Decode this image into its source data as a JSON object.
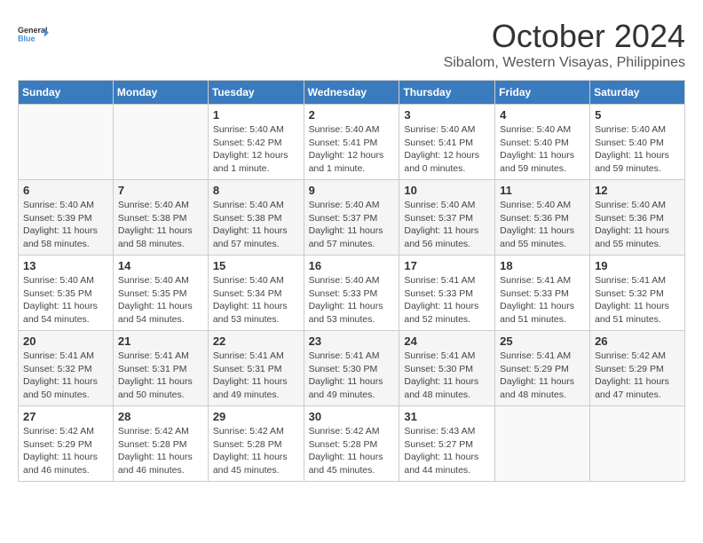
{
  "logo": {
    "line1": "General",
    "line2": "Blue"
  },
  "title": "October 2024",
  "subtitle": "Sibalom, Western Visayas, Philippines",
  "headers": [
    "Sunday",
    "Monday",
    "Tuesday",
    "Wednesday",
    "Thursday",
    "Friday",
    "Saturday"
  ],
  "weeks": [
    [
      {
        "day": "",
        "info": ""
      },
      {
        "day": "",
        "info": ""
      },
      {
        "day": "1",
        "info": "Sunrise: 5:40 AM\nSunset: 5:42 PM\nDaylight: 12 hours\nand 1 minute."
      },
      {
        "day": "2",
        "info": "Sunrise: 5:40 AM\nSunset: 5:41 PM\nDaylight: 12 hours\nand 1 minute."
      },
      {
        "day": "3",
        "info": "Sunrise: 5:40 AM\nSunset: 5:41 PM\nDaylight: 12 hours\nand 0 minutes."
      },
      {
        "day": "4",
        "info": "Sunrise: 5:40 AM\nSunset: 5:40 PM\nDaylight: 11 hours\nand 59 minutes."
      },
      {
        "day": "5",
        "info": "Sunrise: 5:40 AM\nSunset: 5:40 PM\nDaylight: 11 hours\nand 59 minutes."
      }
    ],
    [
      {
        "day": "6",
        "info": "Sunrise: 5:40 AM\nSunset: 5:39 PM\nDaylight: 11 hours\nand 58 minutes."
      },
      {
        "day": "7",
        "info": "Sunrise: 5:40 AM\nSunset: 5:38 PM\nDaylight: 11 hours\nand 58 minutes."
      },
      {
        "day": "8",
        "info": "Sunrise: 5:40 AM\nSunset: 5:38 PM\nDaylight: 11 hours\nand 57 minutes."
      },
      {
        "day": "9",
        "info": "Sunrise: 5:40 AM\nSunset: 5:37 PM\nDaylight: 11 hours\nand 57 minutes."
      },
      {
        "day": "10",
        "info": "Sunrise: 5:40 AM\nSunset: 5:37 PM\nDaylight: 11 hours\nand 56 minutes."
      },
      {
        "day": "11",
        "info": "Sunrise: 5:40 AM\nSunset: 5:36 PM\nDaylight: 11 hours\nand 55 minutes."
      },
      {
        "day": "12",
        "info": "Sunrise: 5:40 AM\nSunset: 5:36 PM\nDaylight: 11 hours\nand 55 minutes."
      }
    ],
    [
      {
        "day": "13",
        "info": "Sunrise: 5:40 AM\nSunset: 5:35 PM\nDaylight: 11 hours\nand 54 minutes."
      },
      {
        "day": "14",
        "info": "Sunrise: 5:40 AM\nSunset: 5:35 PM\nDaylight: 11 hours\nand 54 minutes."
      },
      {
        "day": "15",
        "info": "Sunrise: 5:40 AM\nSunset: 5:34 PM\nDaylight: 11 hours\nand 53 minutes."
      },
      {
        "day": "16",
        "info": "Sunrise: 5:40 AM\nSunset: 5:33 PM\nDaylight: 11 hours\nand 53 minutes."
      },
      {
        "day": "17",
        "info": "Sunrise: 5:41 AM\nSunset: 5:33 PM\nDaylight: 11 hours\nand 52 minutes."
      },
      {
        "day": "18",
        "info": "Sunrise: 5:41 AM\nSunset: 5:33 PM\nDaylight: 11 hours\nand 51 minutes."
      },
      {
        "day": "19",
        "info": "Sunrise: 5:41 AM\nSunset: 5:32 PM\nDaylight: 11 hours\nand 51 minutes."
      }
    ],
    [
      {
        "day": "20",
        "info": "Sunrise: 5:41 AM\nSunset: 5:32 PM\nDaylight: 11 hours\nand 50 minutes."
      },
      {
        "day": "21",
        "info": "Sunrise: 5:41 AM\nSunset: 5:31 PM\nDaylight: 11 hours\nand 50 minutes."
      },
      {
        "day": "22",
        "info": "Sunrise: 5:41 AM\nSunset: 5:31 PM\nDaylight: 11 hours\nand 49 minutes."
      },
      {
        "day": "23",
        "info": "Sunrise: 5:41 AM\nSunset: 5:30 PM\nDaylight: 11 hours\nand 49 minutes."
      },
      {
        "day": "24",
        "info": "Sunrise: 5:41 AM\nSunset: 5:30 PM\nDaylight: 11 hours\nand 48 minutes."
      },
      {
        "day": "25",
        "info": "Sunrise: 5:41 AM\nSunset: 5:29 PM\nDaylight: 11 hours\nand 48 minutes."
      },
      {
        "day": "26",
        "info": "Sunrise: 5:42 AM\nSunset: 5:29 PM\nDaylight: 11 hours\nand 47 minutes."
      }
    ],
    [
      {
        "day": "27",
        "info": "Sunrise: 5:42 AM\nSunset: 5:29 PM\nDaylight: 11 hours\nand 46 minutes."
      },
      {
        "day": "28",
        "info": "Sunrise: 5:42 AM\nSunset: 5:28 PM\nDaylight: 11 hours\nand 46 minutes."
      },
      {
        "day": "29",
        "info": "Sunrise: 5:42 AM\nSunset: 5:28 PM\nDaylight: 11 hours\nand 45 minutes."
      },
      {
        "day": "30",
        "info": "Sunrise: 5:42 AM\nSunset: 5:28 PM\nDaylight: 11 hours\nand 45 minutes."
      },
      {
        "day": "31",
        "info": "Sunrise: 5:43 AM\nSunset: 5:27 PM\nDaylight: 11 hours\nand 44 minutes."
      },
      {
        "day": "",
        "info": ""
      },
      {
        "day": "",
        "info": ""
      }
    ]
  ]
}
